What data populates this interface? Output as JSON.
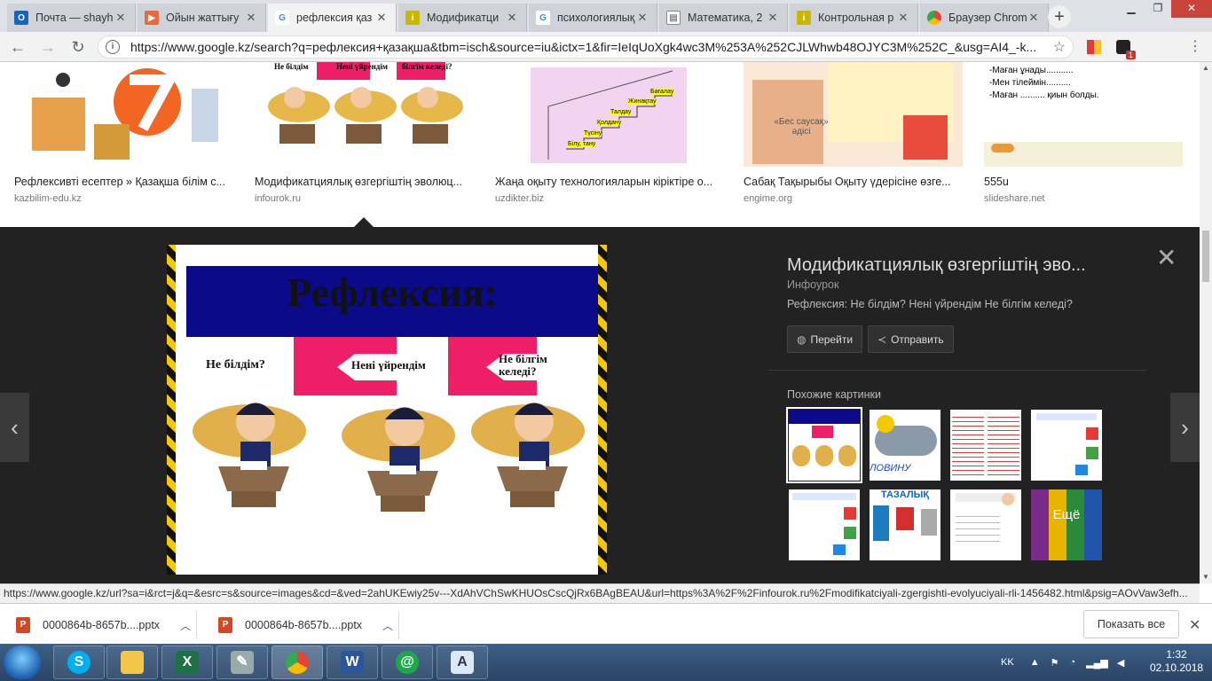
{
  "tabs": [
    {
      "title": "Почта — shayhi",
      "color": "#1565c0"
    },
    {
      "title": "Ойын жаттығу",
      "color": "#e86a3a"
    },
    {
      "title": "рефлексия қаз",
      "color": "#4285f4"
    },
    {
      "title": "Модификатци",
      "color": "#c9b800"
    },
    {
      "title": "психологиялық",
      "color": "#4285f4"
    },
    {
      "title": "Математика, 2",
      "color": "#888888"
    },
    {
      "title": "Контрольная р",
      "color": "#c9b800"
    },
    {
      "title": "Браузер Chrom",
      "color": "#34a853"
    }
  ],
  "address": {
    "url": "https://www.google.kz/search?q=рефлексия+қазақша&tbm=isch&source=iu&ictx=1&fir=IeIqUoXgk4wc3M%253A%252CJLWhwb48OJYC3M%252C_&usg=AI4_-k..."
  },
  "results": [
    {
      "title": "Рефлексивті есептер » Қазақша білім с...",
      "source": "kazbilim-edu.kz"
    },
    {
      "title": "Модификатциялық өзгергіштің эволюц...",
      "source": "infourok.ru"
    },
    {
      "title": "Жаңа оқыту технологияларын кіріктіре о...",
      "source": "uzdikter.biz"
    },
    {
      "title": "Сабақ Тақырыбы Оқыту үдерісіне өзге...",
      "source": "engime.org"
    },
    {
      "title": "555u",
      "source": "slideshare.net"
    }
  ],
  "thumb_text": {
    "r2": [
      "Не білдім",
      "Нені үйрендім",
      "білгім келеді?"
    ],
    "r3": [
      "Бағалау",
      "Жинақтау",
      "Талдау",
      "Қолдану",
      "Түсіну",
      "Білу, тану"
    ],
    "r4": "«Бес саусақ» әдісі",
    "r5": [
      "-Маған ұнады...........",
      "-Мен тілеймін..........",
      "-Маған .......... қиын болды."
    ]
  },
  "viewer": {
    "slide_title": "Рефлексия:",
    "callout1": "Не білдім?",
    "callout2": "Нені үйрендім",
    "callout3": "Не білгім келеді?",
    "title": "Модификатциялық өзгергіштің эво...",
    "source": "Инфоурок",
    "description": "Рефлексия: Не білдім? Нені үйрендім Не білгім келеді?",
    "visit_label": "Перейти",
    "share_label": "Отправить",
    "similar_label": "Похожие картинки",
    "more_label": "Ещё",
    "sim_captions": [
      "ЛОВИНУ",
      "ТАЗАЛЫҚ"
    ]
  },
  "status_url": "https://www.google.kz/url?sa=i&rct=j&q=&esrc=s&source=images&cd=&ved=2ahUKEwiy25v---XdAhVChSwKHUOsCscQjRx6BAgBEAU&url=https%3A%2F%2Finfourok.ru%2Fmodifikatciyali-zgergishti-evolyuciyali-rli-1456482.html&psig=AOvVaw3efh...",
  "downloads": [
    {
      "name": "0000864b-8657b....pptx"
    },
    {
      "name": "0000864b-8657b....pptx"
    }
  ],
  "show_all_label": "Показать все",
  "tray": {
    "lang": "KK"
  },
  "clock": {
    "time": "1:32",
    "date": "02.10.2018"
  }
}
